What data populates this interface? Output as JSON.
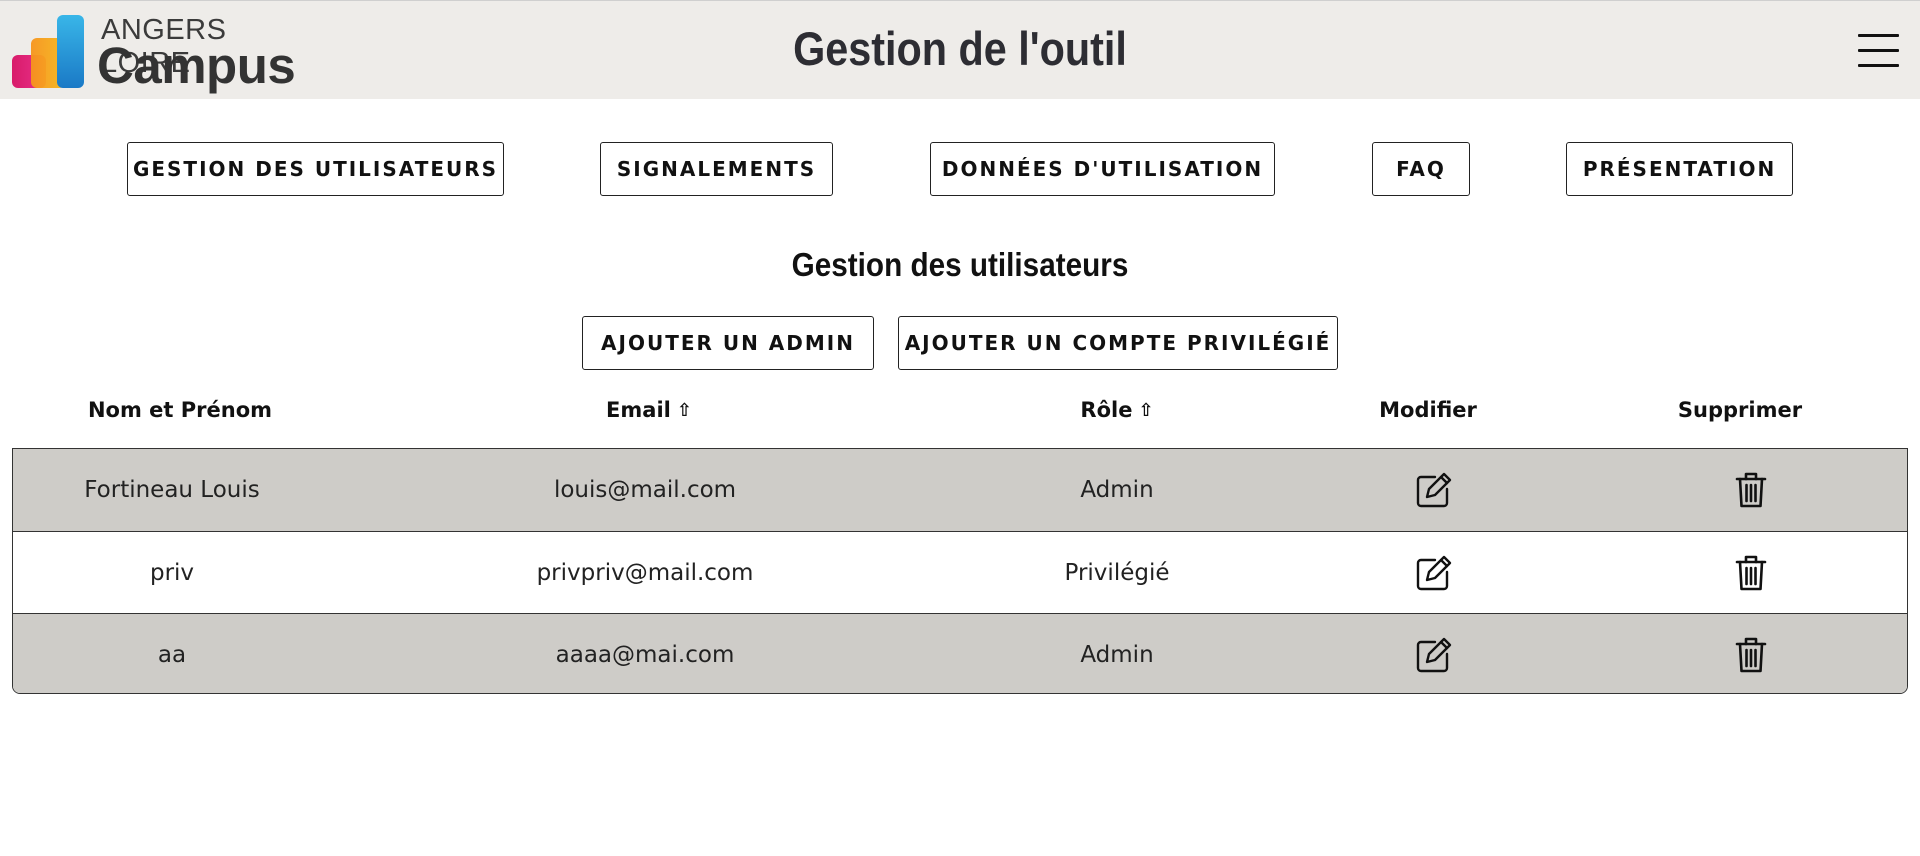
{
  "header": {
    "logo_line1": "ANGERS LOIRE",
    "logo_line2": "Campus",
    "title": "Gestion de l'outil",
    "menu_icon": "hamburger-icon"
  },
  "nav": {
    "users": "GESTION DES UTILISATEURS",
    "reports": "SIGNALEMENTS",
    "usage": "DONNÉES D'UTILISATION",
    "faq": "FAQ",
    "presentation": "PRÉSENTATION"
  },
  "section": {
    "title": "Gestion des utilisateurs",
    "add_admin": "AJOUTER UN ADMIN",
    "add_privileged": "AJOUTER UN COMPTE PRIVILÉGIÉ"
  },
  "table": {
    "headers": {
      "name": "Nom et Prénom",
      "email": "Email",
      "role": "Rôle",
      "edit": "Modifier",
      "delete": "Supprimer"
    },
    "sort_icon": "⇧",
    "rows": [
      {
        "name": "Fortineau Louis",
        "email": "louis@mail.com",
        "role": "Admin"
      },
      {
        "name": "priv",
        "email": "privpriv@mail.com",
        "role": "Privilégié"
      },
      {
        "name": "aa",
        "email": "aaaa@mai.com",
        "role": "Admin"
      }
    ]
  },
  "colors": {
    "header_bg": "#eeece9",
    "row_shaded": "#ceccc8",
    "text": "#111111"
  }
}
